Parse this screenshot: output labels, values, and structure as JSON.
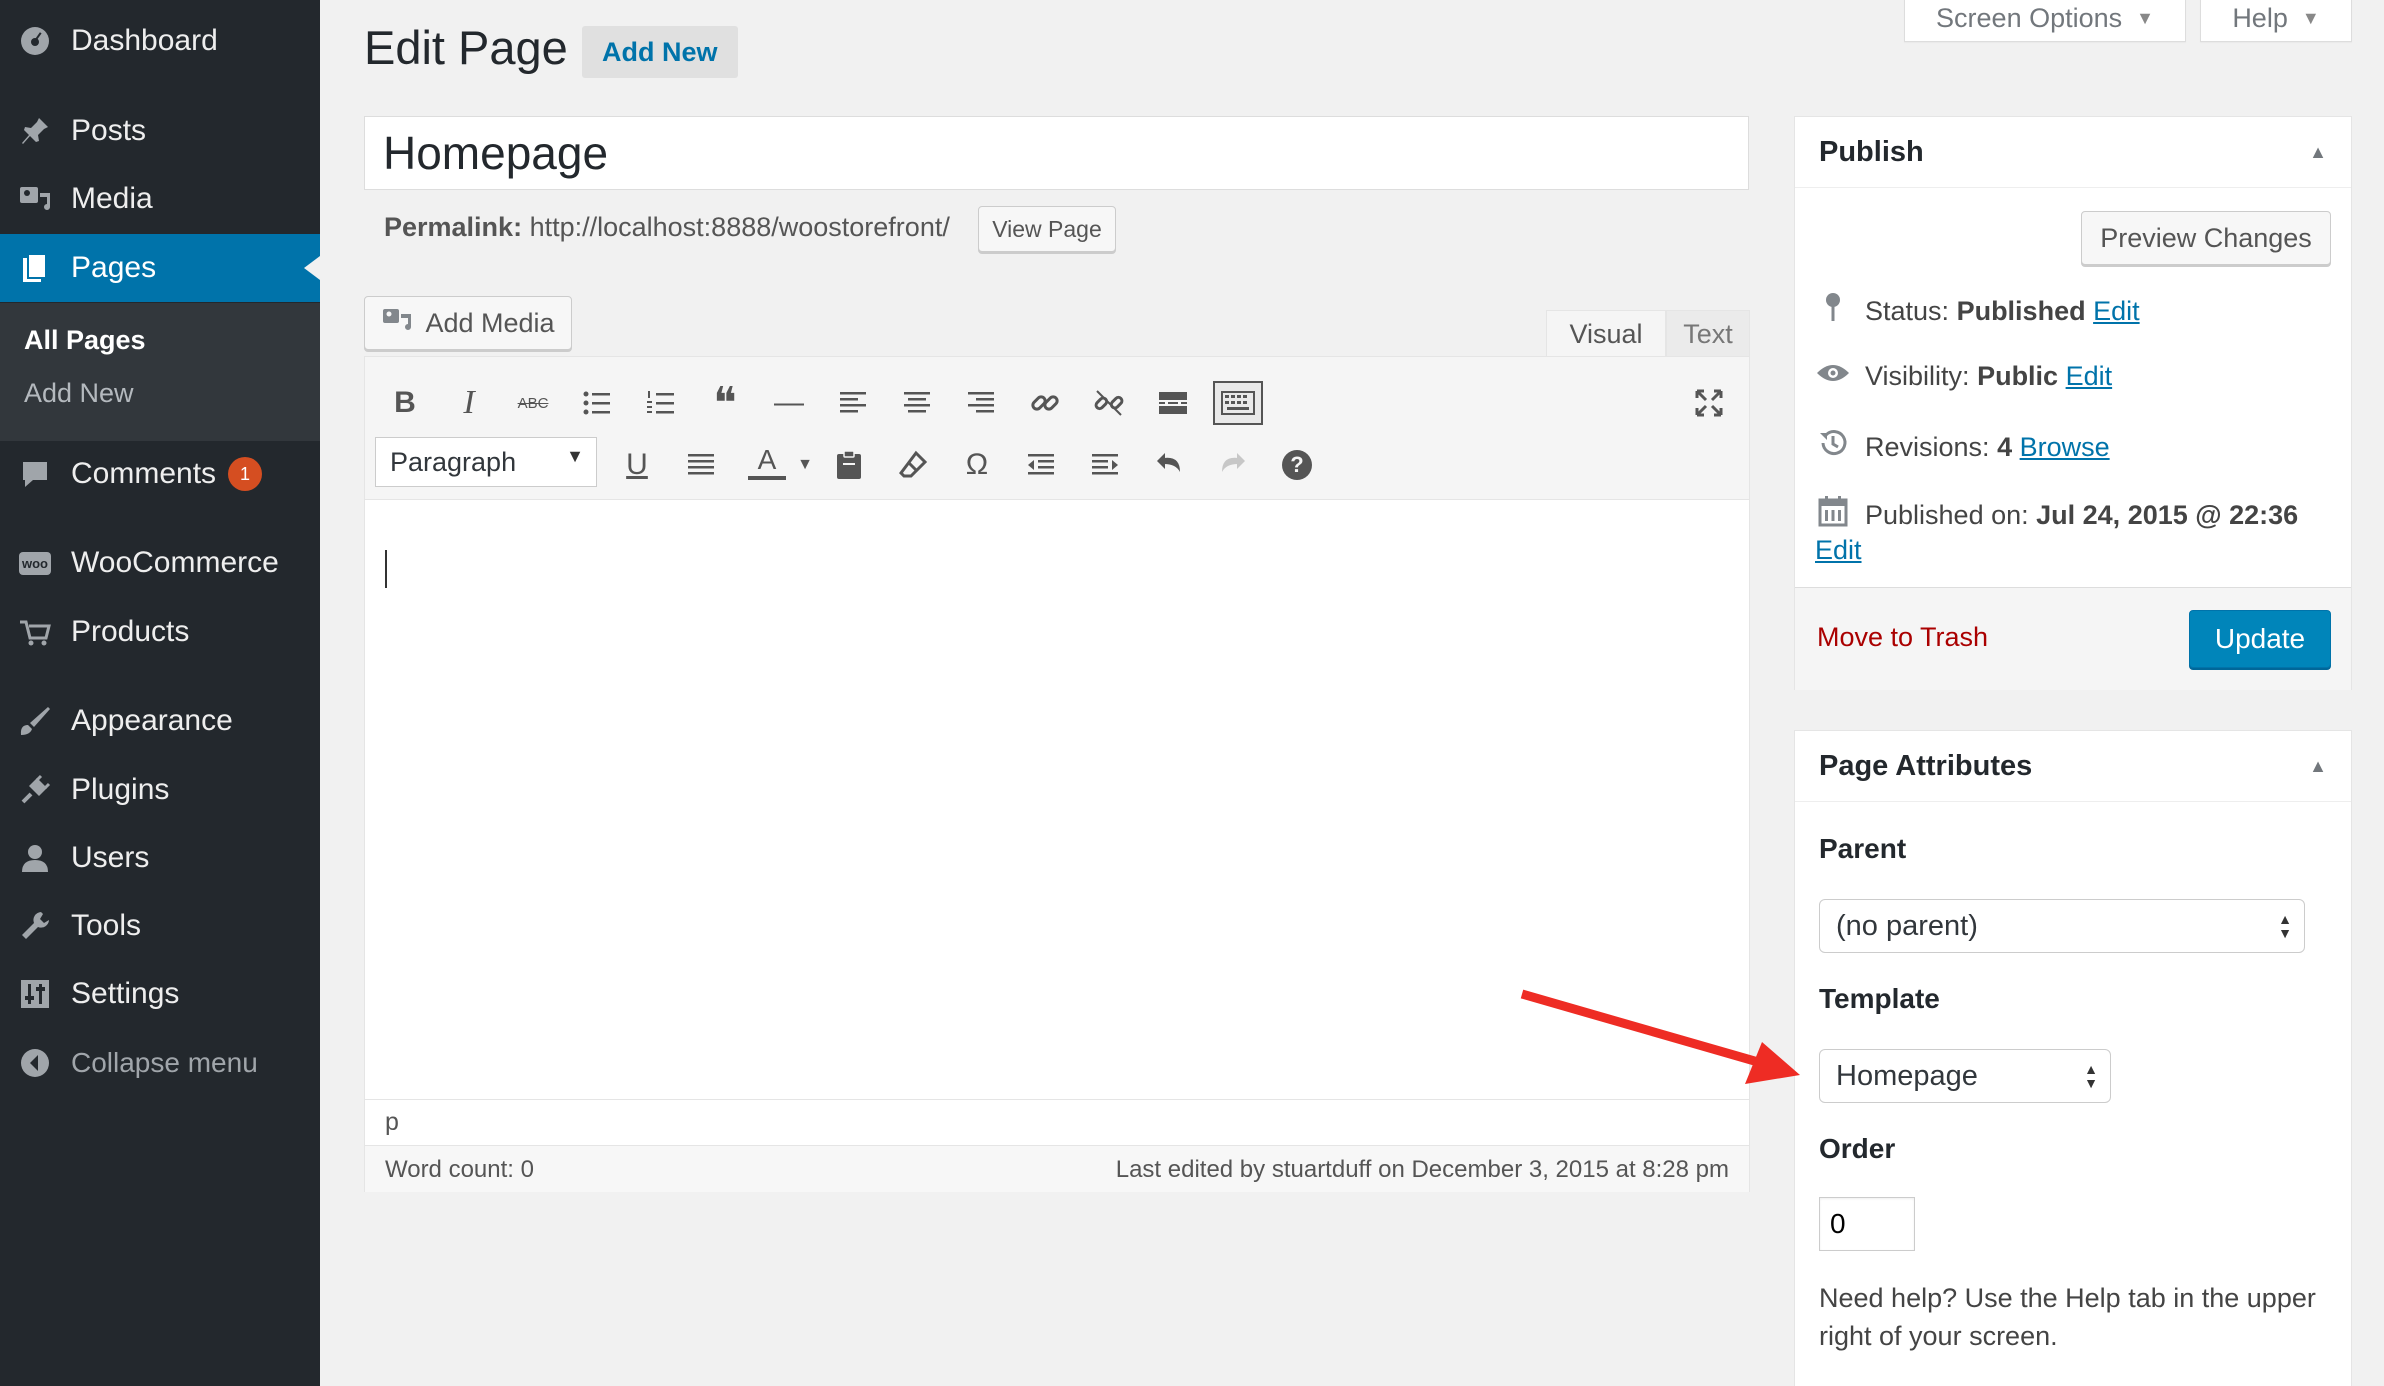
{
  "sidebar": {
    "items": [
      {
        "id": "dashboard",
        "label": "Dashboard",
        "icon": "dashboard-icon"
      },
      {
        "id": "posts",
        "label": "Posts",
        "icon": "pin-icon"
      },
      {
        "id": "media",
        "label": "Media",
        "icon": "media-icon"
      },
      {
        "id": "pages",
        "label": "Pages",
        "icon": "pages-icon"
      },
      {
        "id": "comments",
        "label": "Comments",
        "icon": "comment-icon",
        "badge": "1"
      },
      {
        "id": "woocommerce",
        "label": "WooCommerce",
        "icon": "woo-icon"
      },
      {
        "id": "products",
        "label": "Products",
        "icon": "cart-icon"
      },
      {
        "id": "appearance",
        "label": "Appearance",
        "icon": "brush-icon"
      },
      {
        "id": "plugins",
        "label": "Plugins",
        "icon": "plug-icon"
      },
      {
        "id": "users",
        "label": "Users",
        "icon": "user-icon"
      },
      {
        "id": "tools",
        "label": "Tools",
        "icon": "wrench-icon"
      },
      {
        "id": "settings",
        "label": "Settings",
        "icon": "sliders-icon"
      },
      {
        "id": "collapse",
        "label": "Collapse menu",
        "icon": "collapse-icon"
      }
    ],
    "submenu": [
      "All Pages",
      "Add New"
    ],
    "woo_icon_text": "woo"
  },
  "header": {
    "title": "Edit Page",
    "add_new": "Add New",
    "screen_options": "Screen Options",
    "help": "Help"
  },
  "post": {
    "title": "Homepage",
    "permalink_label": "Permalink:",
    "permalink_url": "http://localhost:8888/woostorefront/",
    "view_page": "View Page"
  },
  "editor": {
    "add_media": "Add Media",
    "tab_visual": "Visual",
    "tab_text": "Text",
    "format_select": "Paragraph",
    "path": "p",
    "word_count": "Word count: 0",
    "last_edited": "Last edited by stuartduff on December 3, 2015 at 8:28 pm",
    "toolbar_glyphs": {
      "bold": "B",
      "italic": "I",
      "strike": "ABC",
      "quote": "❝",
      "hr": "—",
      "underline": "U",
      "text_color": "A",
      "omega": "Ω",
      "help": "?"
    }
  },
  "publish": {
    "title": "Publish",
    "preview": "Preview Changes",
    "status_label": "Status:",
    "status_value": "Published",
    "visibility_label": "Visibility:",
    "visibility_value": "Public",
    "revisions_label": "Revisions:",
    "revisions_value": "4",
    "browse": "Browse",
    "published_label": "Published on:",
    "published_value": "Jul 24, 2015 @ 22:36",
    "edit": "Edit",
    "trash": "Move to Trash",
    "update": "Update"
  },
  "attributes": {
    "title": "Page Attributes",
    "parent_label": "Parent",
    "parent_value": "(no parent)",
    "template_label": "Template",
    "template_value": "Homepage",
    "order_label": "Order",
    "order_value": "0",
    "help_text": "Need help? Use the Help tab in the upper right of your screen."
  },
  "colors": {
    "accent": "#0073aa",
    "sidebar": "#23282d",
    "trash": "#a00",
    "annotation": "#ee2c24"
  }
}
